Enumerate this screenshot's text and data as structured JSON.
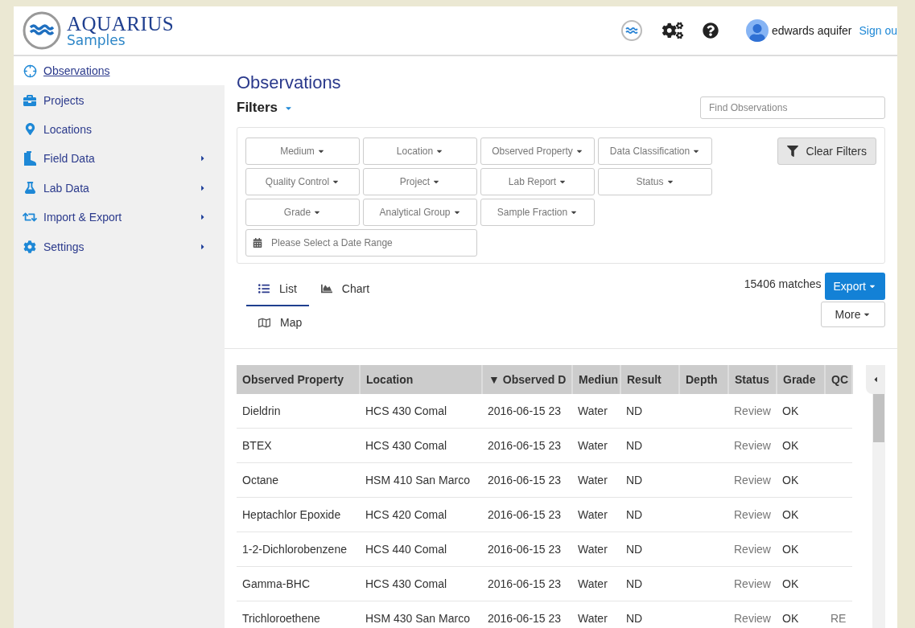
{
  "header": {
    "logo_title": "AQUARIUS",
    "logo_subtitle": "Samples",
    "user": "edwards aquifer",
    "sign_out": "Sign ou"
  },
  "sidebar": {
    "items": [
      {
        "label": "Observations",
        "selected": true,
        "expandable": false
      },
      {
        "label": "Projects",
        "selected": false,
        "expandable": false
      },
      {
        "label": "Locations",
        "selected": false,
        "expandable": false
      },
      {
        "label": "Field Data",
        "selected": false,
        "expandable": true
      },
      {
        "label": "Lab Data",
        "selected": false,
        "expandable": true
      },
      {
        "label": "Import & Export",
        "selected": false,
        "expandable": true
      },
      {
        "label": "Settings",
        "selected": false,
        "expandable": true
      }
    ]
  },
  "page": {
    "title": "Observations",
    "filters_label": "Filters",
    "search": {
      "placeholder": "Find Observations"
    }
  },
  "filters": {
    "dropdowns": [
      [
        "Medium",
        "Location",
        "Observed Property",
        "Data Classification"
      ],
      [
        "Quality Control",
        "Project",
        "Lab Report",
        "Status"
      ],
      [
        "Grade",
        "Analytical Group",
        "Sample Fraction"
      ]
    ],
    "date_range": {
      "placeholder": "Please Select a Date Range"
    },
    "clear_button": "Clear Filters"
  },
  "views": {
    "tabs": [
      {
        "label": "List",
        "selected": true
      },
      {
        "label": "Chart",
        "selected": false
      },
      {
        "label": "Map",
        "selected": false
      }
    ],
    "matches": "15406 matches",
    "export_button": "Export",
    "more_button": "More"
  },
  "table": {
    "columns": [
      "Observed Property",
      "Location",
      "▼ Observed D",
      "Mediun",
      "Result",
      "Depth",
      "Status",
      "Grade",
      "QC"
    ],
    "rows": [
      [
        "Dieldrin",
        "HCS 430 Comal",
        "2016-06-15 23",
        "Water",
        "ND",
        "",
        "Review",
        "OK",
        ""
      ],
      [
        "BTEX",
        "HCS 430 Comal",
        "2016-06-15 23",
        "Water",
        "ND",
        "",
        "Review",
        "OK",
        ""
      ],
      [
        "Octane",
        "HSM 410 San Marco",
        "2016-06-15 23",
        "Water",
        "ND",
        "",
        "Review",
        "OK",
        ""
      ],
      [
        "Heptachlor Epoxide",
        "HCS 420 Comal",
        "2016-06-15 23",
        "Water",
        "ND",
        "",
        "Review",
        "OK",
        ""
      ],
      [
        "1-2-Dichlorobenzene",
        "HCS 440 Comal",
        "2016-06-15 23",
        "Water",
        "ND",
        "",
        "Review",
        "OK",
        ""
      ],
      [
        "Gamma-BHC",
        "HCS 430 Comal",
        "2016-06-15 23",
        "Water",
        "ND",
        "",
        "Review",
        "OK",
        ""
      ],
      [
        "Trichloroethene",
        "HSM 430 San Marco",
        "2016-06-15 23",
        "Water",
        "ND",
        "",
        "Review",
        "OK",
        "RE"
      ]
    ]
  }
}
